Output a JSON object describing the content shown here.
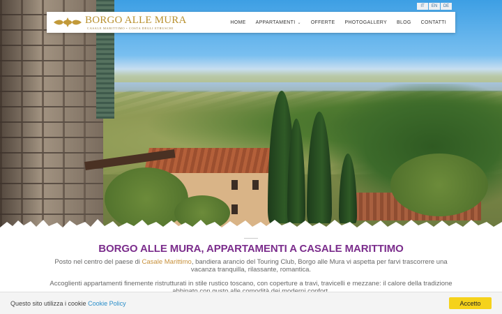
{
  "languages": [
    "IT",
    "EN",
    "DE"
  ],
  "logo": {
    "name": "BORGO ALLE MURA",
    "tagline": "CASALE MARITTIMO  •  COSTA DEGLI ETRUSCHI"
  },
  "nav": {
    "items": [
      {
        "label": "HOME"
      },
      {
        "label": "APPARTAMENTI",
        "has_dropdown": true
      },
      {
        "label": "OFFERTE"
      },
      {
        "label": "PHOTOGALLERY"
      },
      {
        "label": "BLOG"
      },
      {
        "label": "CONTATTI"
      }
    ]
  },
  "content": {
    "title": "BORGO ALLE MURA, APPARTAMENTI A CASALE MARITTIMO",
    "para1_pre": "Posto nel centro del paese di ",
    "para1_link": "Casale Marittimo",
    "para1_post": ", bandiera arancio del Touring Club, Borgo alle Mura vi aspetta per farvi trascorrere una vacanza tranquilla, rilassante, romantica.",
    "para2": "Accoglienti appartamenti finemente ristrutturati in stile rustico toscano, con coperture a travi, travicelli e mezzane: il calore della tradizione abbinato con gusto alle comodità dei moderni confort."
  },
  "cookie": {
    "text": "Questo sito utilizza i cookie",
    "link": "Cookie Policy",
    "accept": "Accetto"
  },
  "colors": {
    "title": "#7b2d8c",
    "link": "#c7903a",
    "accept_button": "#f5d21b",
    "logo_gold": "#b8902e"
  }
}
